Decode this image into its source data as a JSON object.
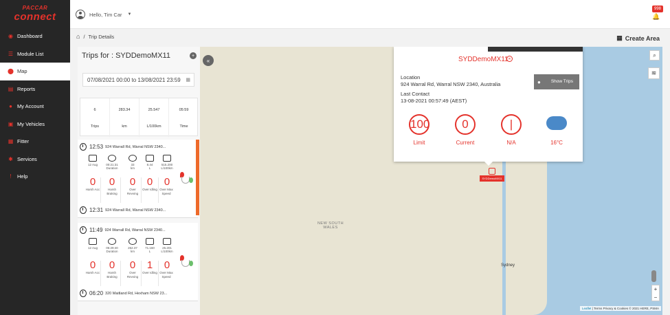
{
  "brand": {
    "top": "PACCAR",
    "name": "connect"
  },
  "nav": [
    {
      "label": "Dashboard",
      "icon": "dashboard-icon"
    },
    {
      "label": "Module List",
      "icon": "list-icon"
    },
    {
      "label": "Map",
      "icon": "map-pin-icon"
    },
    {
      "label": "Reports",
      "icon": "reports-icon"
    },
    {
      "label": "My Account",
      "icon": "account-icon"
    },
    {
      "label": "My Vehicles",
      "icon": "vehicles-icon"
    },
    {
      "label": "Fitter",
      "icon": "fitter-icon"
    },
    {
      "label": "Services",
      "icon": "services-icon"
    },
    {
      "label": "Help",
      "icon": "help-icon"
    }
  ],
  "active_nav": "Map",
  "user": {
    "greeting": "Hello, Tim Car"
  },
  "notifications": {
    "count": "998"
  },
  "breadcrumb": {
    "separator": "/",
    "current": "Trip Details"
  },
  "create_area": "Create Area",
  "panel": {
    "title": "Trips for : SYDDemoMX11",
    "date_range": "07/08/2021 00:00 to 13/08/2021 23:59",
    "summary": [
      {
        "value": "6",
        "label": "Trips"
      },
      {
        "value": "283.34",
        "label": "km"
      },
      {
        "value": "25.547",
        "label": "L/100km"
      },
      {
        "value": "05:59",
        "label": "Time"
      }
    ]
  },
  "trips": [
    {
      "time": "12:53",
      "address": "924 Warrall Rd, Warral NSW 2340...",
      "metrics": [
        {
          "v": "12 Aug",
          "l": ""
        },
        {
          "v": "00:21:31",
          "l": "Duration"
        },
        {
          "v": "33",
          "l": "km"
        },
        {
          "v": "8.44",
          "l": "L"
        },
        {
          "v": "515.200",
          "l": "L/100km"
        }
      ],
      "events": [
        {
          "v": "0",
          "l": "Harsh Acc"
        },
        {
          "v": "0",
          "l": "Harsh Braking"
        },
        {
          "v": "0",
          "l": "Over Revving"
        },
        {
          "v": "0",
          "l": "Over Idling"
        },
        {
          "v": "0",
          "l": "Over Max Speed"
        }
      ],
      "end_time": "12:31",
      "end_address": "924 Warrall Rd, Warral NSW 2340..."
    },
    {
      "time": "11:49",
      "address": "924 Warrall Rd, Warral NSW 2340...",
      "metrics": [
        {
          "v": "12 Aug",
          "l": ""
        },
        {
          "v": "05:29:40",
          "l": "Duration"
        },
        {
          "v": "262.37",
          "l": "km"
        },
        {
          "v": "71.160",
          "l": "L"
        },
        {
          "v": "25.201",
          "l": "L/100km"
        }
      ],
      "events": [
        {
          "v": "0",
          "l": "Harsh Acc"
        },
        {
          "v": "0",
          "l": "Harsh Braking"
        },
        {
          "v": "0",
          "l": "Over Revving"
        },
        {
          "v": "1",
          "l": "Over Idling"
        },
        {
          "v": "0",
          "l": "Over Max Speed"
        }
      ],
      "end_time": "06:20",
      "end_address": "320 Maitland Rd, Hexham NSW 23..."
    }
  ],
  "popup": {
    "vehicle": "SYDDemoMX11",
    "location_label": "Location",
    "location": "924 Warral Rd, Warral NSW 2340, Australia",
    "last_contact_label": "Last Contact",
    "last_contact": "13-08-2021 00:57:49 (AEST)",
    "show_trips": "Show Trips",
    "limit_value": "100",
    "limit_label": "Limit",
    "current_value": "0",
    "current_label": "Current",
    "na_value": "|",
    "na_label": "N/A",
    "temperature": "16°C"
  },
  "map": {
    "region_label": "NEW SOUTH WALES",
    "city": "Sydney",
    "marker_tag": "SYDDemoMX11",
    "attribution_link": "Leaflet",
    "attribution": "| Terms Privacy & Cookies © 2021 HERE, PSMA"
  },
  "colors": {
    "accent": "#e4322b",
    "sidebar": "#262626",
    "trip_bar": "#ee6a2a"
  }
}
